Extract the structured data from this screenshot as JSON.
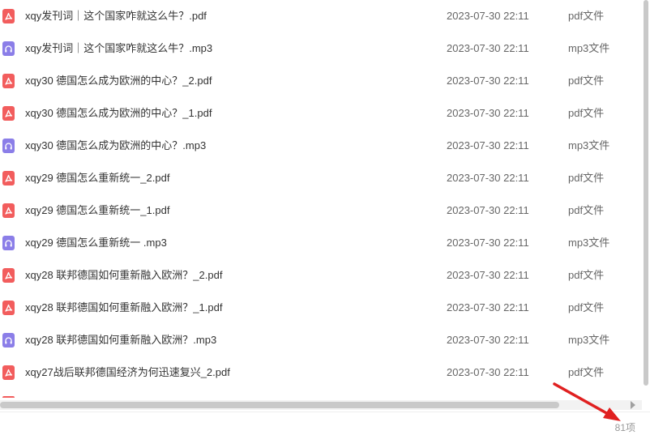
{
  "files": [
    {
      "name": "xqy发刊词｜这个国家咋就这么牛？.pdf",
      "date": "2023-07-30 22:11",
      "type_label": "pdf文件",
      "kind": "pdf"
    },
    {
      "name": "xqy发刊词｜这个国家咋就这么牛？.mp3",
      "date": "2023-07-30 22:11",
      "type_label": "mp3文件",
      "kind": "mp3"
    },
    {
      "name": "xqy30 德国怎么成为欧洲的中心？_2.pdf",
      "date": "2023-07-30 22:11",
      "type_label": "pdf文件",
      "kind": "pdf"
    },
    {
      "name": "xqy30 德国怎么成为欧洲的中心？_1.pdf",
      "date": "2023-07-30 22:11",
      "type_label": "pdf文件",
      "kind": "pdf"
    },
    {
      "name": "xqy30 德国怎么成为欧洲的中心？.mp3",
      "date": "2023-07-30 22:11",
      "type_label": "mp3文件",
      "kind": "mp3"
    },
    {
      "name": "xqy29 德国怎么重新统一_2.pdf",
      "date": "2023-07-30 22:11",
      "type_label": "pdf文件",
      "kind": "pdf"
    },
    {
      "name": "xqy29 德国怎么重新统一_1.pdf",
      "date": "2023-07-30 22:11",
      "type_label": "pdf文件",
      "kind": "pdf"
    },
    {
      "name": "xqy29 德国怎么重新统一 .mp3",
      "date": "2023-07-30 22:11",
      "type_label": "mp3文件",
      "kind": "mp3"
    },
    {
      "name": "xqy28 联邦德国如何重新融入欧洲？_2.pdf",
      "date": "2023-07-30 22:11",
      "type_label": "pdf文件",
      "kind": "pdf"
    },
    {
      "name": "xqy28 联邦德国如何重新融入欧洲？_1.pdf",
      "date": "2023-07-30 22:11",
      "type_label": "pdf文件",
      "kind": "pdf"
    },
    {
      "name": "xqy28 联邦德国如何重新融入欧洲？.mp3",
      "date": "2023-07-30 22:11",
      "type_label": "mp3文件",
      "kind": "mp3"
    },
    {
      "name": "xqy27战后联邦德国经济为何迅速复兴_2.pdf",
      "date": "2023-07-30 22:11",
      "type_label": "pdf文件",
      "kind": "pdf"
    }
  ],
  "status": {
    "item_count": "81项"
  },
  "icons": {
    "pdf": "pdf-file-icon",
    "mp3": "audio-file-icon"
  },
  "colors": {
    "pdf_icon": "#f25d5d",
    "mp3_icon": "#8b7ee8",
    "annotation_arrow": "#e02020"
  }
}
